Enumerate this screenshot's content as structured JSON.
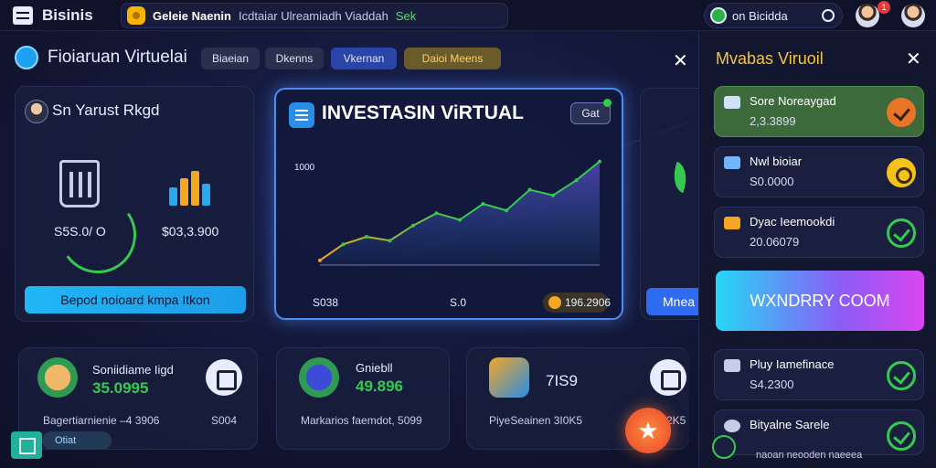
{
  "topbar": {
    "app_title": "Bisinis",
    "search_chip": "Geleie Naenin",
    "search_text": "Icdtaiar Ulreamiadh Viaddah",
    "search_accent": "Sek",
    "user_chip_label": "on Bicidda",
    "notif_count": "1"
  },
  "header": {
    "brand_title": "Fioiaruan Virtuelai",
    "tabs": [
      {
        "label": "Biaeian"
      },
      {
        "label": "Dkenns"
      },
      {
        "label": "Vkernan"
      },
      {
        "label": "Daioi Meens"
      }
    ]
  },
  "profile_card": {
    "name": "Sn Yarust Rkgd",
    "metric_left": "S5S.0/ O",
    "metric_right": "$03,3.900",
    "cta_label": "Bepod noioard kmpa Itkon"
  },
  "chart_card": {
    "title": "INVESTASIN ViRTUAL",
    "button_label": "Gat",
    "y_tick": "1000",
    "x_start": "S038",
    "x_mid": "S.0",
    "total": "196.2906",
    "chart_data": {
      "type": "line",
      "x": [
        0,
        1,
        2,
        3,
        4,
        5,
        6,
        7,
        8,
        9,
        10,
        11,
        12
      ],
      "values": [
        5,
        22,
        30,
        26,
        42,
        55,
        48,
        65,
        58,
        80,
        74,
        90,
        110
      ],
      "ylim": [
        0,
        130
      ]
    }
  },
  "peek_card": {
    "button_label": "Mnea"
  },
  "stat_cards": [
    {
      "title": "Soniidiame Iigd",
      "value": "35.0995",
      "foot_left": "Bagertiarnienie –4 3906",
      "foot_right": "S004"
    },
    {
      "title": "Gniebll",
      "value": "49.896",
      "foot_left": "Markarios faemdot, 5099",
      "foot_right": ""
    },
    {
      "title": "7IS9",
      "value": "",
      "foot_left": "PiyeSeainen 3I0K5",
      "foot_right": "2K5"
    }
  ],
  "bottom": {
    "chip_label": "Otiat"
  },
  "right_panel": {
    "title": "Mvabas Viruoil",
    "items": [
      {
        "label": "Sore Noreaygad",
        "value": "2,3.3899"
      },
      {
        "label": "Nwl bioiar",
        "value": "S0.0000"
      },
      {
        "label": "Dyac Ieemookdi",
        "value": "20.06079"
      }
    ],
    "banner": "WXNDRRY COOM",
    "items2": [
      {
        "label": "Pluy Iamefinace",
        "value": "S4.2300"
      },
      {
        "label": "Bityalne Sarele",
        "value": ""
      }
    ],
    "foot": "naoan   neooden   naeeea"
  },
  "colors": {
    "accent": "#36c94f",
    "brand_blue": "#2a8de8",
    "gold": "#f5c542",
    "orange": "#e8742a"
  }
}
